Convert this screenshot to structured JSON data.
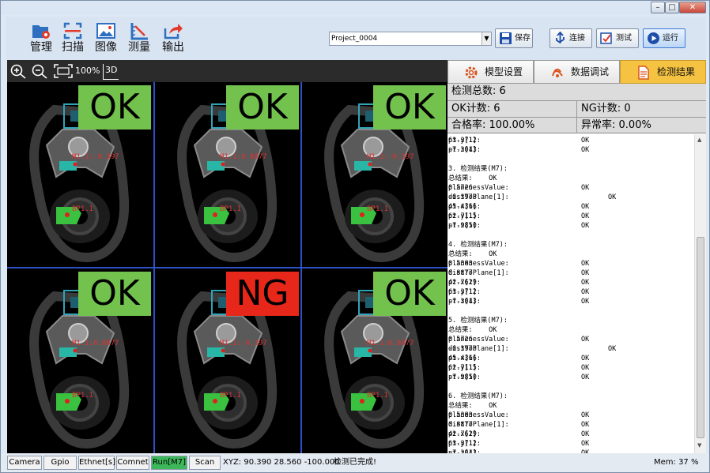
{
  "toolbar": {
    "items": [
      {
        "label": "管理",
        "icon": "folder-gear-icon"
      },
      {
        "label": "扫描",
        "icon": "scan-icon"
      },
      {
        "label": "图像",
        "icon": "image-icon"
      },
      {
        "label": "测量",
        "icon": "ruler-icon"
      },
      {
        "label": "输出",
        "icon": "export-icon"
      }
    ],
    "project": "Project_0004",
    "save": "保存",
    "connect": "连接",
    "test": "测试",
    "run": "运行"
  },
  "view": {
    "zoom": "100%",
    "mode": "3D"
  },
  "cells": [
    {
      "result": "OK",
      "label1": "M1.1:-0.397",
      "label2": "BP1.1"
    },
    {
      "result": "OK",
      "label1": "M1.1:0.8877",
      "label2": "BP1.1"
    },
    {
      "result": "OK",
      "label1": "M1.1:-0.397",
      "label2": "BP1.1"
    },
    {
      "result": "OK",
      "label1": "M1.1:0.8877",
      "label2": "BP1.1"
    },
    {
      "result": "NG",
      "label1": "M1.1:-0.397",
      "label2": "BP1.1"
    },
    {
      "result": "OK",
      "label1": "M1.1:0.8877",
      "label2": "BP1.1"
    }
  ],
  "colors": {
    "ok": "#73c24e",
    "ng": "#e8271b",
    "grid": "#2d52c8",
    "accent": "#f5c242"
  },
  "tabs": [
    {
      "label": "模型设置",
      "icon": "gear-icon"
    },
    {
      "label": "数据调试",
      "icon": "data-debug-icon"
    },
    {
      "label": "检测结果",
      "icon": "document-icon"
    }
  ],
  "stats": {
    "total_label": "检测总数:",
    "total": "6",
    "ok_label": "OK计数:",
    "ok": "6",
    "ng_label": "NG计数:",
    "ng": "0",
    "pass_label": "合格率:",
    "pass": "100.00%",
    "abn_label": "异常率:",
    "abn": "0.00%"
  },
  "log": [
    {
      "a": "pt-y[1]:",
      "b": "63.3712",
      "c": "OK",
      "d": ""
    },
    {
      "a": "pt-z[1]:",
      "b": "-7.3043",
      "c": "OK",
      "d": ""
    },
    {
      "a": "",
      "b": "",
      "c": "",
      "d": ""
    },
    {
      "a": "3. 检测结果(M7):",
      "b": "",
      "c": "",
      "d": ""
    },
    {
      "a": "总结果:    OK",
      "b": "",
      "c": "",
      "d": ""
    },
    {
      "a": "planenessValue:",
      "b": "0.5726",
      "c": "OK",
      "d": ""
    },
    {
      "a": "distToPlane[1]:",
      "b": "-0.3978",
      "c": "",
      "d": "OK"
    },
    {
      "a": "pt-x[1]:",
      "b": "45.4366",
      "c": "OK",
      "d": ""
    },
    {
      "a": "pt-y[1]:",
      "b": "62.7115",
      "c": "OK",
      "d": ""
    },
    {
      "a": "pt-z[1]:",
      "b": "-7.9850",
      "c": "OK",
      "d": ""
    },
    {
      "a": "",
      "b": "",
      "c": "",
      "d": ""
    },
    {
      "a": "4. 检测结果(M7):",
      "b": "",
      "c": "",
      "d": ""
    },
    {
      "a": "总结果:    OK",
      "b": "",
      "c": "",
      "d": ""
    },
    {
      "a": "planenessValue:",
      "b": "0.5383",
      "c": "OK",
      "d": ""
    },
    {
      "a": "distToPlane[1]:",
      "b": "0.8877",
      "c": "OK",
      "d": ""
    },
    {
      "a": "pt-x[1]:",
      "b": "42.7629",
      "c": "OK",
      "d": ""
    },
    {
      "a": "pt-y[1]:",
      "b": "63.3712",
      "c": "OK",
      "d": ""
    },
    {
      "a": "pt-z[1]:",
      "b": "-7.3043",
      "c": "OK",
      "d": ""
    },
    {
      "a": "",
      "b": "",
      "c": "",
      "d": ""
    },
    {
      "a": "5. 检测结果(M7):",
      "b": "",
      "c": "",
      "d": ""
    },
    {
      "a": "总结果:    OK",
      "b": "",
      "c": "",
      "d": ""
    },
    {
      "a": "planenessValue:",
      "b": "0.5726",
      "c": "OK",
      "d": ""
    },
    {
      "a": "distToPlane[1]:",
      "b": "-0.3978",
      "c": "",
      "d": "OK"
    },
    {
      "a": "pt-x[1]:",
      "b": "45.4366",
      "c": "OK",
      "d": ""
    },
    {
      "a": "pt-y[1]:",
      "b": "62.7115",
      "c": "OK",
      "d": ""
    },
    {
      "a": "pt-z[1]:",
      "b": "-7.9850",
      "c": "OK",
      "d": ""
    },
    {
      "a": "",
      "b": "",
      "c": "",
      "d": ""
    },
    {
      "a": "6. 检测结果(M7):",
      "b": "",
      "c": "",
      "d": ""
    },
    {
      "a": "总结果:    OK",
      "b": "",
      "c": "",
      "d": ""
    },
    {
      "a": "planenessValue:",
      "b": "0.5383",
      "c": "OK",
      "d": ""
    },
    {
      "a": "distToPlane[1]:",
      "b": "0.8877",
      "c": "OK",
      "d": ""
    },
    {
      "a": "pt-x[1]:",
      "b": "42.7629",
      "c": "OK",
      "d": ""
    },
    {
      "a": "pt-y[1]:",
      "b": "63.3712",
      "c": "OK",
      "d": ""
    },
    {
      "a": "pt-z[1]:",
      "b": "-7.3043",
      "c": "OK",
      "d": ""
    }
  ],
  "status": {
    "camera": "Camera",
    "gpio": "Gpio",
    "ethnet": "Ethnet[s]",
    "comnet": "Comnet",
    "run": "Run[M7]",
    "scan": "Scan",
    "xyz": "XYZ: 90.390  28.560  -100.000",
    "msg": "检测已完成!",
    "mem": "Mem: 37 %"
  }
}
